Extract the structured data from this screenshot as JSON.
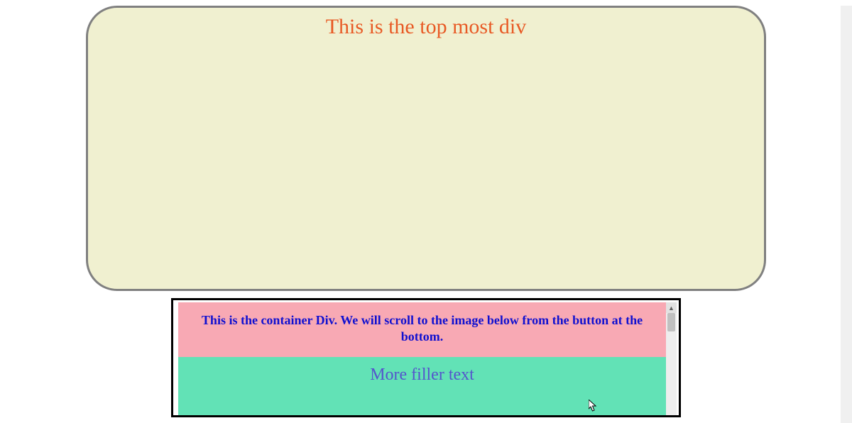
{
  "top_div": {
    "title": "This is the top most div"
  },
  "container": {
    "header_text": "This is the container Div. We will scroll to the image below from the button at the bottom.",
    "filler_text": "More filler text"
  },
  "colors": {
    "top_bg": "#f0f0d0",
    "top_border": "#808080",
    "top_title": "#e85a25",
    "container_border": "#000000",
    "pink_bg": "#f8a9b4",
    "pink_text": "#1010d0",
    "green_bg": "#62e2b6",
    "green_text": "#5555cc"
  }
}
